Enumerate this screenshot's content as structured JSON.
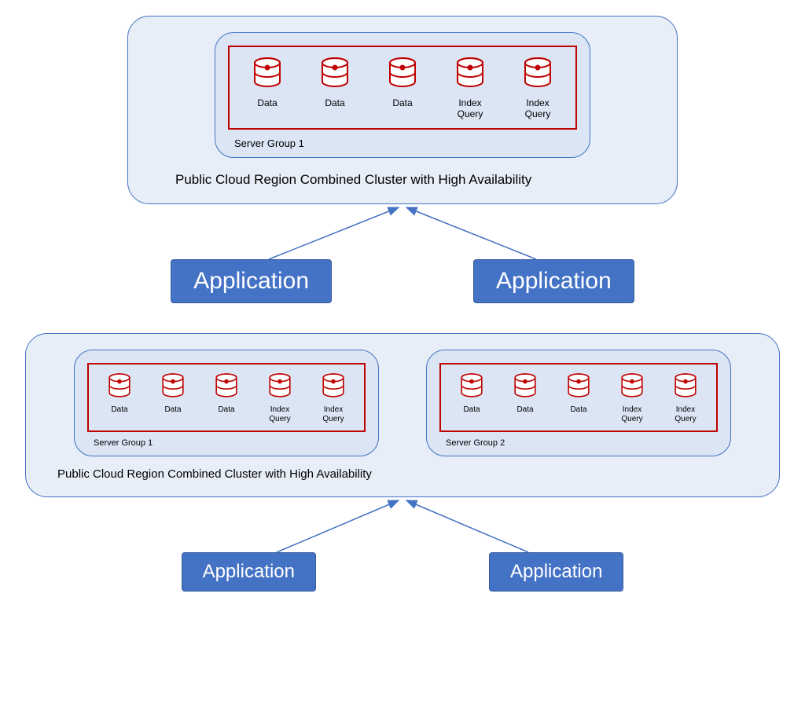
{
  "colors": {
    "region_bg": "#e8eef8",
    "region_border": "#4472c4",
    "group_bg": "#dbe5f4",
    "group_border": "#4472c4",
    "nodes_border": "#c00000",
    "app_bg": "#4472c4",
    "app_fg": "#ffffff",
    "arrow": "#4472c4"
  },
  "icon": {
    "database": "database-icon"
  },
  "top": {
    "region_label": "Public Cloud Region Combined Cluster with High Availability",
    "groups": [
      {
        "label": "Server Group 1",
        "nodes": [
          {
            "label": "Data"
          },
          {
            "label": "Data"
          },
          {
            "label": "Data"
          },
          {
            "label": "Index Query"
          },
          {
            "label": "Index Query"
          }
        ]
      }
    ],
    "apps": [
      {
        "label": "Application"
      },
      {
        "label": "Application"
      }
    ]
  },
  "bottom": {
    "region_label": "Public Cloud Region Combined Cluster with High Availability",
    "groups": [
      {
        "label": "Server Group 1",
        "nodes": [
          {
            "label": "Data"
          },
          {
            "label": "Data"
          },
          {
            "label": "Data"
          },
          {
            "label": "Index Query"
          },
          {
            "label": "Index Query"
          }
        ]
      },
      {
        "label": "Server Group 2",
        "nodes": [
          {
            "label": "Data"
          },
          {
            "label": "Data"
          },
          {
            "label": "Data"
          },
          {
            "label": "Index Query"
          },
          {
            "label": "Index Query"
          }
        ]
      }
    ],
    "apps": [
      {
        "label": "Application"
      },
      {
        "label": "Application"
      }
    ]
  }
}
